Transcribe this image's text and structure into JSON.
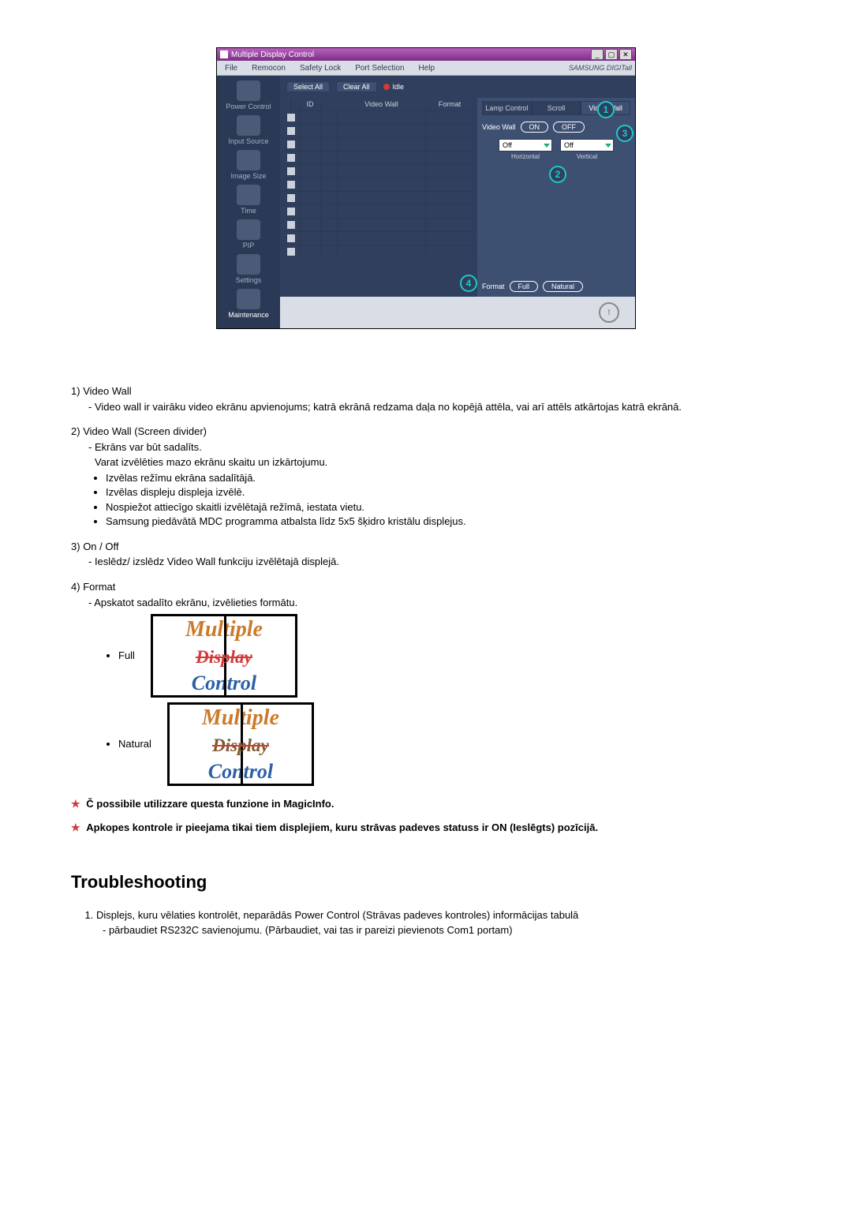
{
  "app": {
    "title": "Multiple Display Control",
    "menus": [
      "File",
      "Remocon",
      "Safety Lock",
      "Port Selection",
      "Help"
    ],
    "brand": "SAMSUNG DIGITall",
    "sidebar": [
      {
        "label": "Power Control"
      },
      {
        "label": "Input Source"
      },
      {
        "label": "Image Size"
      },
      {
        "label": "Time"
      },
      {
        "label": "PIP"
      },
      {
        "label": "Settings"
      },
      {
        "label": "Maintenance"
      }
    ],
    "toolbar": {
      "select_all": "Select All",
      "clear_all": "Clear All",
      "status": "Idle"
    },
    "grid_headers": {
      "chk": "",
      "id": "ID",
      "st": "",
      "vw": "Video Wall",
      "fmt": "Format"
    },
    "grid_rows": 11,
    "panel": {
      "tabs": [
        "Lamp Control",
        "Scroll",
        "Video Wall"
      ],
      "row_label": "Video Wall",
      "on": "ON",
      "off": "OFF",
      "h_sel": "Off",
      "h_sub": "Horizontal",
      "v_sel": "Off",
      "v_sub": "Vertical",
      "format_label": "Format",
      "full": "Full",
      "natural": "Natural"
    }
  },
  "doc": {
    "items": [
      {
        "n": "1)",
        "title": "Video Wall",
        "dash": "- Video wall ir vairāku video ekrānu apvienojums; katrā ekrānā redzama daļa no kopējā attēla, vai arī attēls atkārtojas katrā ekrānā."
      },
      {
        "n": "2)",
        "title": "Video Wall (Screen divider)",
        "dash": "- Ekrāns var būt sadalīts.",
        "dash2": "Varat izvēlēties mazo ekrānu skaitu un izkārtojumu.",
        "bullets": [
          "Izvēlas režīmu ekrāna sadalītājā.",
          "Izvēlas displeju displeja izvēlē.",
          "Nospiežot attiecīgo skaitli izvēlētajā režīmā, iestata vietu.",
          "Samsung piedāvātā MDC programma atbalsta līdz 5x5 šķidro kristālu displejus."
        ]
      },
      {
        "n": "3)",
        "title": "On / Off",
        "dash": "- Ieslēdz/ izslēdz Video Wall funkciju izvēlētajā displejā."
      },
      {
        "n": "4)",
        "title": "Format",
        "dash": "- Apskatot sadalīto ekrānu, izvēlieties formātu."
      }
    ],
    "fmt_full": "Full",
    "fmt_natural": "Natural",
    "mdc_text": {
      "l1": "Multiple",
      "l2": "Display",
      "l3": "Control"
    },
    "notes": [
      "Č possibile utilizzare questa funzione in MagicInfo.",
      "Apkopes kontrole ir pieejama tikai tiem displejiem, kuru strāvas padeves statuss ir ON (Ieslēgts) pozīcijā."
    ]
  },
  "troubleshooting": {
    "heading": "Troubleshooting",
    "item1": "Displejs, kuru vēlaties kontrolēt, neparādās Power Control (Strāvas padeves kontroles) informācijas tabulā",
    "item1_sub": "- pārbaudiet RS232C savienojumu. (Pārbaudiet, vai tas ir pareizi pievienots Com1 portam)"
  }
}
